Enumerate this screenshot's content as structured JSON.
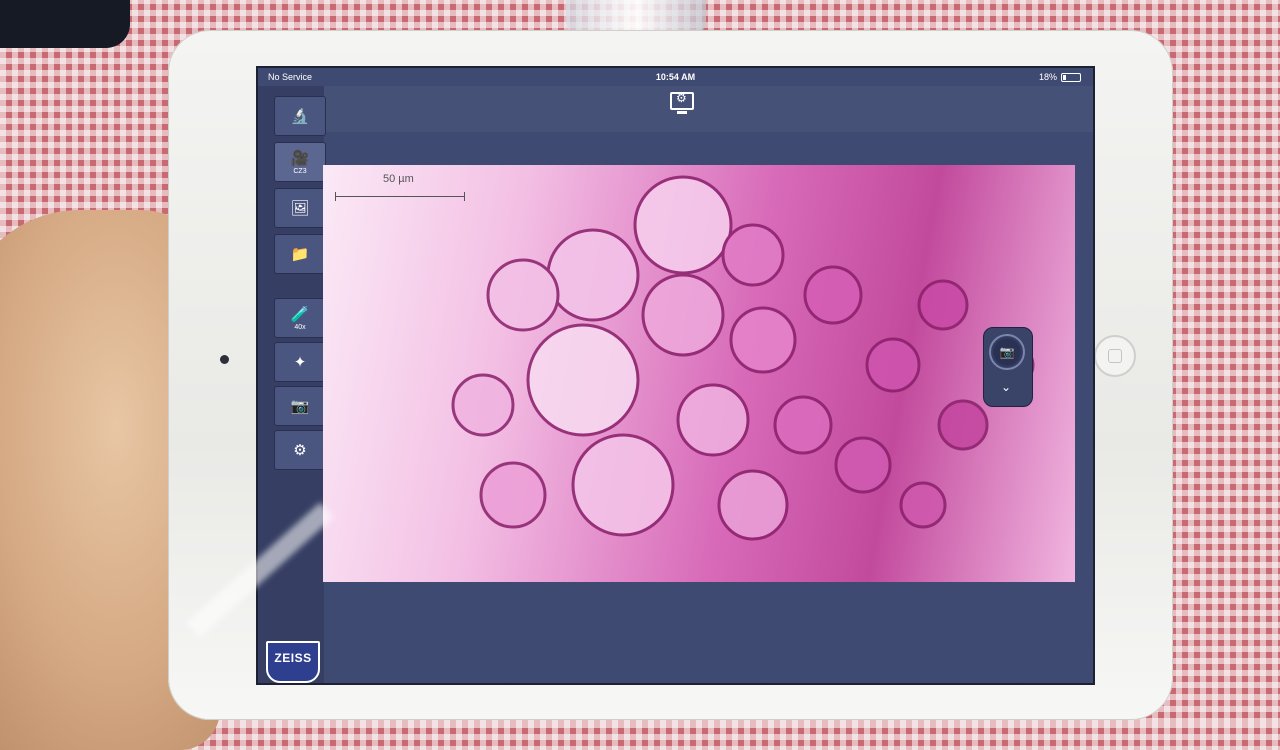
{
  "status_bar": {
    "carrier": "No Service",
    "time": "10:54 AM",
    "battery": "18%"
  },
  "toolbar": {
    "settings_icon": "monitor-settings-icon"
  },
  "sidebar": {
    "items": [
      {
        "icon": "microscope-icon",
        "label": ""
      },
      {
        "icon": "camera-device-icon",
        "label": "CZ3"
      },
      {
        "icon": "image-gallery-icon",
        "label": ""
      },
      {
        "icon": "folder-icon",
        "label": ""
      },
      {
        "icon": "objective-icon",
        "label": "40x"
      },
      {
        "icon": "light-settings-icon",
        "label": ""
      },
      {
        "icon": "camera-settings-icon",
        "label": ""
      },
      {
        "icon": "microscope-settings-icon",
        "label": ""
      }
    ],
    "logo": "ZEISS"
  },
  "live_image": {
    "scale_bar_label": "50 µm"
  },
  "snap": {
    "snap_icon": "camera-icon",
    "expand_icon": "chevron-down-icon"
  },
  "colors": {
    "ui_background": "#3f4a72",
    "sidebar": "#363f63",
    "stain": "#c24a9d"
  }
}
